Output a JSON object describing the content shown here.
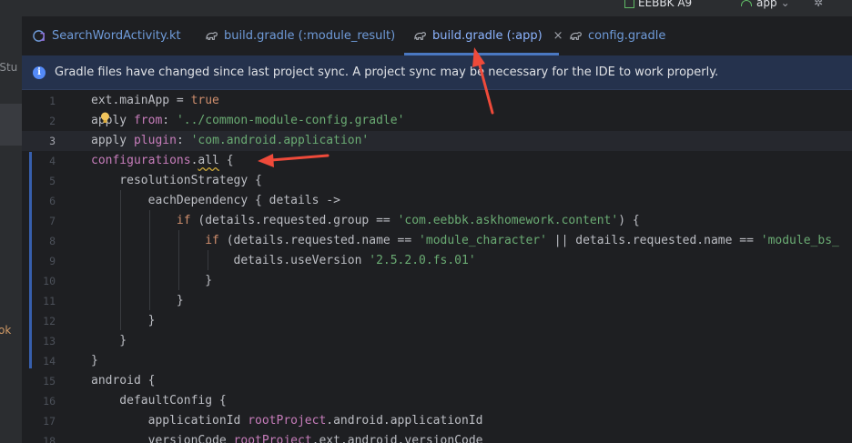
{
  "top_bar": {
    "device_selector": "EEBBK A9",
    "run_config": "app"
  },
  "left_panel": {
    "partial_label": "lStu",
    "partial_label_2": "ok"
  },
  "tabs": [
    {
      "label": "SearchWordActivity.kt",
      "icon": "kotlin-file-icon",
      "active": false
    },
    {
      "label": "build.gradle (:module_result)",
      "icon": "gradle-elephant-icon",
      "active": false
    },
    {
      "label": "build.gradle (:app)",
      "icon": "gradle-elephant-icon",
      "active": true
    },
    {
      "label": "config.gradle",
      "icon": "gradle-elephant-icon",
      "active": false
    }
  ],
  "tab_close_glyph": "×",
  "banner": {
    "icon": "info-icon",
    "message": "Gradle files have changed since last project sync. A project sync may be necessary for the IDE to work properly."
  },
  "editor": {
    "current_line": 3,
    "lines": [
      {
        "n": "1",
        "segs": [
          [
            "p",
            "ext.mainApp = "
          ],
          [
            "kw",
            "true"
          ]
        ]
      },
      {
        "n": "2",
        "segs": [
          [
            "p",
            "apply "
          ],
          [
            "prop",
            "from"
          ],
          [
            "p",
            ": "
          ],
          [
            "str",
            "'../common-module-config.gradle'"
          ]
        ]
      },
      {
        "n": "3",
        "segs": [
          [
            "p",
            "apply "
          ],
          [
            "prop",
            "plugin"
          ],
          [
            "p",
            ": "
          ],
          [
            "str",
            "'com.android.application'"
          ]
        ]
      },
      {
        "n": "4",
        "segs": [
          [
            "fld",
            "configurations"
          ],
          [
            "p",
            "."
          ],
          [
            "p",
            "all"
          ],
          [
            "p",
            " {"
          ]
        ]
      },
      {
        "n": "5",
        "segs": [
          [
            "p",
            "    resolutionStrategy {"
          ]
        ]
      },
      {
        "n": "6",
        "segs": [
          [
            "p",
            "        eachDependency { details ->"
          ]
        ]
      },
      {
        "n": "7",
        "segs": [
          [
            "p",
            "            "
          ],
          [
            "kw",
            "if"
          ],
          [
            "p",
            " (details.requested.group == "
          ],
          [
            "str",
            "'com.eebbk.askhomework.content'"
          ],
          [
            "p",
            ") {"
          ]
        ]
      },
      {
        "n": "8",
        "segs": [
          [
            "p",
            "                "
          ],
          [
            "kw",
            "if"
          ],
          [
            "p",
            " (details.requested.name == "
          ],
          [
            "str",
            "'module_character'"
          ],
          [
            "p",
            " || details.requested.name == "
          ],
          [
            "str",
            "'module_bs_"
          ]
        ]
      },
      {
        "n": "9",
        "segs": [
          [
            "p",
            "                    details.useVersion "
          ],
          [
            "str",
            "'2.5.2.0.fs.01'"
          ]
        ]
      },
      {
        "n": "10",
        "segs": [
          [
            "p",
            "                }"
          ]
        ]
      },
      {
        "n": "11",
        "segs": [
          [
            "p",
            "            }"
          ]
        ]
      },
      {
        "n": "12",
        "segs": [
          [
            "p",
            "        }"
          ]
        ]
      },
      {
        "n": "13",
        "segs": [
          [
            "p",
            "    }"
          ]
        ]
      },
      {
        "n": "14",
        "segs": [
          [
            "p",
            "}"
          ]
        ]
      },
      {
        "n": "15",
        "segs": [
          [
            "p",
            "android {"
          ]
        ]
      },
      {
        "n": "16",
        "segs": [
          [
            "p",
            "    defaultConfig {"
          ]
        ]
      },
      {
        "n": "17",
        "segs": [
          [
            "p",
            "        applicationId "
          ],
          [
            "fld",
            "rootProject"
          ],
          [
            "p",
            ".android.applicationId"
          ]
        ]
      },
      {
        "n": "18",
        "segs": [
          [
            "p",
            "        versionCode "
          ],
          [
            "fld",
            "rootProject"
          ],
          [
            "p",
            ".ext.android.versionCode"
          ]
        ]
      }
    ]
  },
  "annotations": [
    {
      "type": "arrow",
      "color": "#ee4a3a",
      "points_to": "build.gradle (:app) tab"
    },
    {
      "type": "arrow",
      "color": "#ee4a3a",
      "points_to": "configurations.all"
    }
  ],
  "colors": {
    "background": "#1e1f22",
    "banner": "#25324d",
    "accent": "#548af7",
    "keyword": "#cf8e6d",
    "string": "#6aab73",
    "field": "#c77dbb",
    "annotation": "#ee4a3a"
  }
}
